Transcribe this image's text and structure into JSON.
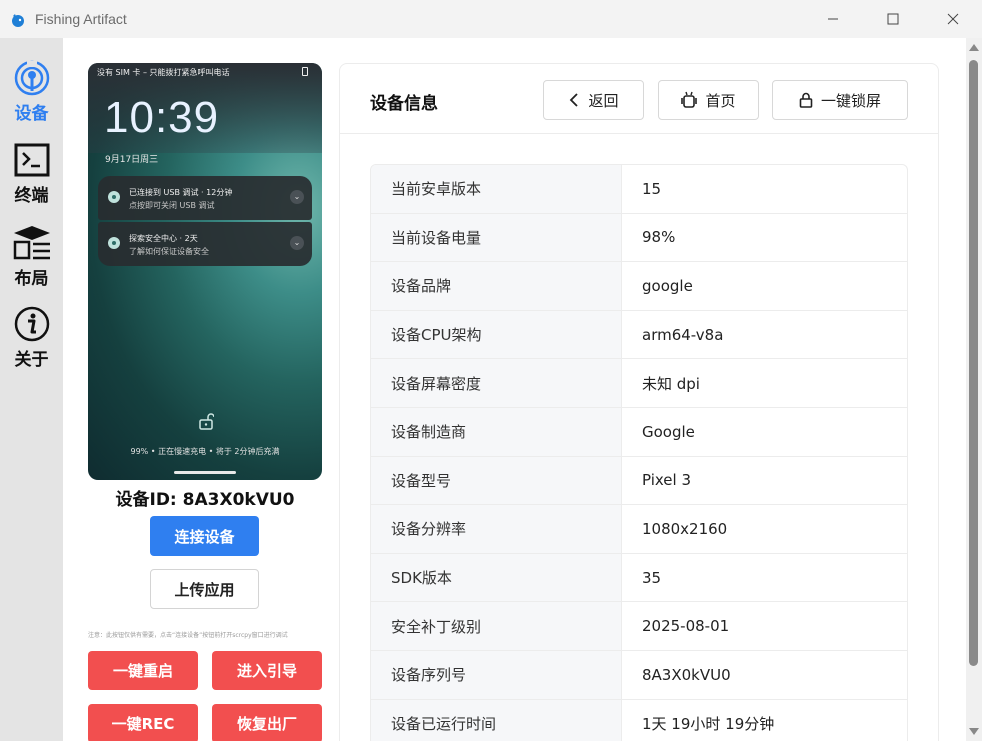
{
  "window": {
    "title": "Fishing Artifact",
    "icon": "fish-app-icon",
    "controls": [
      "minimize-icon",
      "maximize-icon",
      "close-icon"
    ]
  },
  "nav": {
    "items": [
      {
        "label": "设备",
        "icon": "device-signal-icon",
        "active": true
      },
      {
        "label": "终端",
        "icon": "terminal-icon",
        "active": false
      },
      {
        "label": "布局",
        "icon": "layout-icon",
        "active": false
      },
      {
        "label": "关于",
        "icon": "info-icon",
        "active": false
      }
    ],
    "active_color": "#2f7ff0"
  },
  "phone": {
    "status": "没有 SIM 卡 – 只能拨打紧急呼叫电话",
    "time": "10:39",
    "date": "9月17日周三",
    "notifications": [
      {
        "title": "已连接到 USB 调试 · 12分钟",
        "body": "点按即可关闭 USB 调试"
      },
      {
        "title": "探索安全中心 · 2天",
        "body": "了解如何保证设备安全"
      }
    ],
    "charging": "99% • 正在慢速充电 • 将于 2分钟后充满"
  },
  "device_id": "设备ID: 8A3X0kVU0",
  "actions": {
    "connect": "连接设备",
    "upload": "上传应用",
    "note": "注意：此按钮仅供有需要，点击“连接设备”按钮前打开scrcpy窗口进行调试",
    "reboot": "一键重启",
    "guide": "进入引导",
    "rec": "一键REC",
    "factory": "恢复出厂"
  },
  "colors": {
    "primary": "#2f7ff0",
    "danger": "#f24f4f"
  },
  "info": {
    "title": "设备信息",
    "back": "返回",
    "home": "首页",
    "lock": "一键锁屏",
    "rows": [
      {
        "key": "当前安卓版本",
        "value": "15"
      },
      {
        "key": "当前设备电量",
        "value": "98%"
      },
      {
        "key": "设备品牌",
        "value": "google"
      },
      {
        "key": "设备CPU架构",
        "value": "arm64-v8a"
      },
      {
        "key": "设备屏幕密度",
        "value": "未知 dpi"
      },
      {
        "key": "设备制造商",
        "value": "Google"
      },
      {
        "key": "设备型号",
        "value": "Pixel 3"
      },
      {
        "key": "设备分辨率",
        "value": "1080x2160"
      },
      {
        "key": "SDK版本",
        "value": "35"
      },
      {
        "key": "安全补丁级别",
        "value": "2025-08-01"
      },
      {
        "key": "设备序列号",
        "value": "8A3X0kVU0"
      },
      {
        "key": "设备已运行时间",
        "value": "1天 19小时 19分钟"
      }
    ]
  }
}
